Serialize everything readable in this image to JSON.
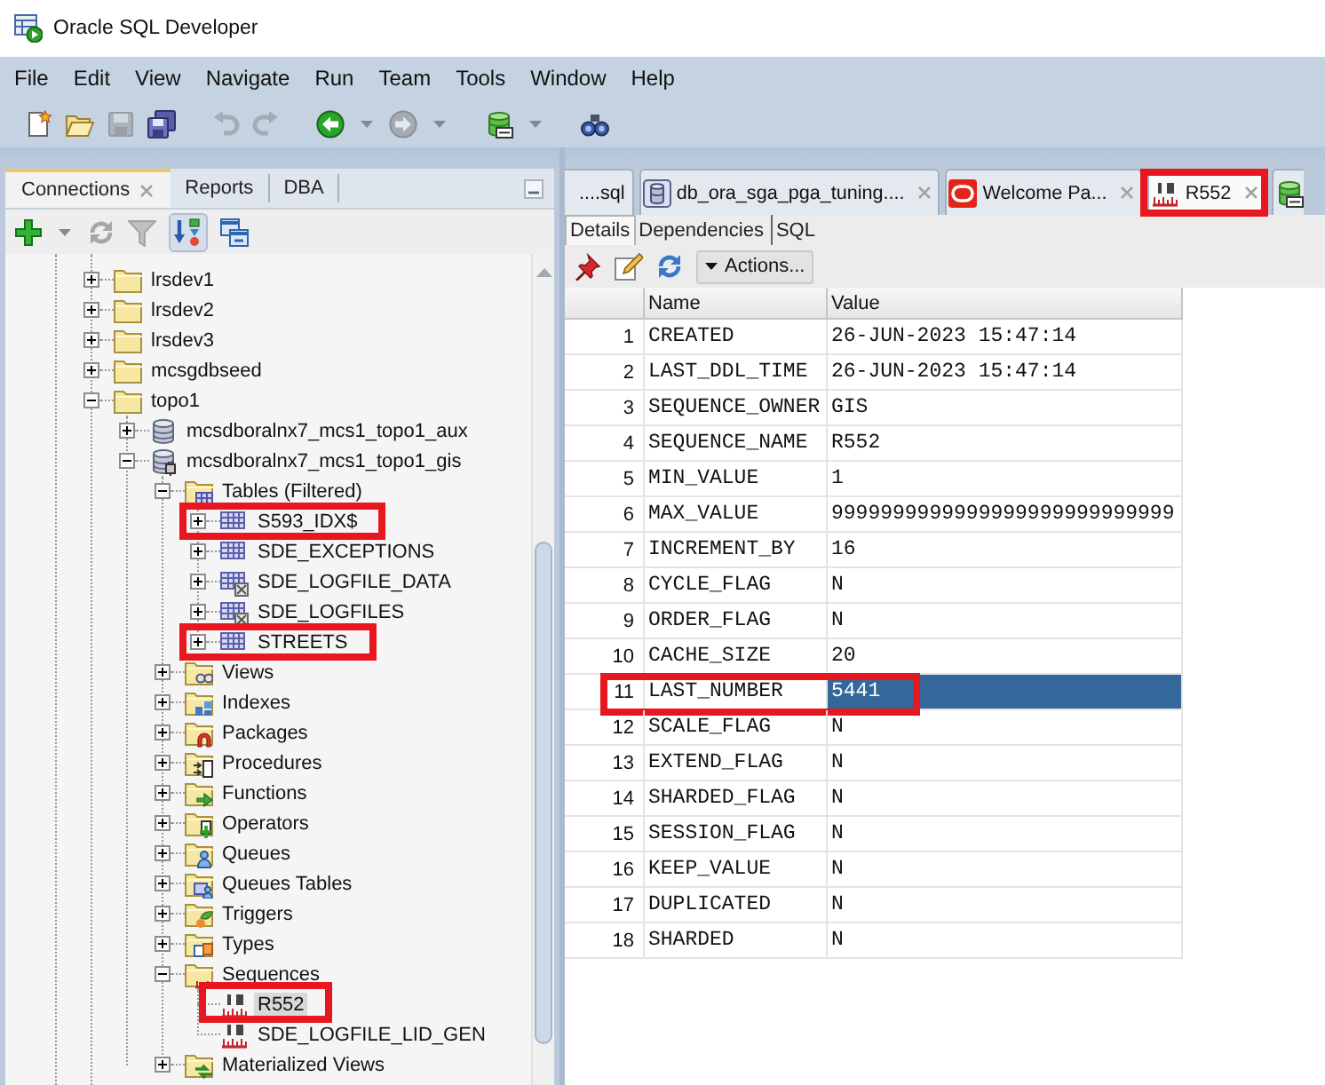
{
  "window": {
    "title": "Oracle SQL Developer"
  },
  "menu_bar": [
    "File",
    "Edit",
    "View",
    "Navigate",
    "Run",
    "Team",
    "Tools",
    "Window",
    "Help"
  ],
  "toolbar": [
    {
      "kind": "new",
      "disabled": false
    },
    {
      "kind": "open",
      "disabled": false
    },
    {
      "kind": "save",
      "disabled": true
    },
    {
      "kind": "save-all",
      "disabled": false
    },
    {
      "kind": "undo",
      "disabled": true
    },
    {
      "kind": "redo",
      "disabled": true
    },
    {
      "kind": "back",
      "disabled": false
    },
    {
      "kind": "dropdown",
      "disabled": false
    },
    {
      "kind": "forward",
      "disabled": true
    },
    {
      "kind": "dropdown",
      "disabled": false
    },
    {
      "kind": "sql",
      "disabled": false
    },
    {
      "kind": "dropdown",
      "disabled": false
    },
    {
      "kind": "find",
      "disabled": false
    }
  ],
  "left_panel": {
    "tabs": [
      {
        "label": "Connections",
        "selected": true,
        "closable": true
      },
      {
        "label": "Reports",
        "selected": false,
        "closable": false
      },
      {
        "label": "DBA",
        "selected": false,
        "closable": false
      }
    ],
    "toolbar": [
      {
        "kind": "add",
        "disabled": false,
        "pressed": false
      },
      {
        "kind": "dropdown",
        "disabled": false,
        "pressed": false
      },
      {
        "kind": "refresh",
        "disabled": true,
        "pressed": false
      },
      {
        "kind": "filter",
        "disabled": true,
        "pressed": false
      },
      {
        "kind": "schema-browser",
        "disabled": false,
        "pressed": true
      },
      {
        "kind": "collapse",
        "disabled": false,
        "pressed": false
      }
    ],
    "tree": [
      {
        "label": "lrsdev1",
        "kind": "folder",
        "expanded": false,
        "selected": false,
        "highlighted": false
      },
      {
        "label": "lrsdev2",
        "kind": "folder",
        "expanded": false,
        "selected": false,
        "highlighted": false
      },
      {
        "label": "lrsdev3",
        "kind": "folder",
        "expanded": false,
        "selected": false,
        "highlighted": false
      },
      {
        "label": "mcsgdbseed",
        "kind": "folder",
        "expanded": false,
        "selected": false,
        "highlighted": false
      },
      {
        "label": "topo1",
        "kind": "folder",
        "expanded": true,
        "selected": false,
        "highlighted": false,
        "children": [
          {
            "label": "mcsdboralnx7_mcs1_topo1_aux",
            "kind": "database",
            "expanded": false,
            "selected": false,
            "highlighted": false
          },
          {
            "label": "mcsdboralnx7_mcs1_topo1_gis",
            "kind": "database-connected",
            "expanded": true,
            "selected": false,
            "highlighted": false,
            "children": [
              {
                "label": "Tables (Filtered)",
                "kind": "tables",
                "expanded": true,
                "selected": false,
                "highlighted": false,
                "children": [
                  {
                    "label": "S593_IDX$",
                    "kind": "table",
                    "expanded": false,
                    "selected": false,
                    "highlighted": true
                  },
                  {
                    "label": "SDE_EXCEPTIONS",
                    "kind": "table",
                    "expanded": false,
                    "selected": false,
                    "highlighted": false
                  },
                  {
                    "label": "SDE_LOGFILE_DATA",
                    "kind": "table-x",
                    "expanded": false,
                    "selected": false,
                    "highlighted": false
                  },
                  {
                    "label": "SDE_LOGFILES",
                    "kind": "table-x",
                    "expanded": false,
                    "selected": false,
                    "highlighted": false
                  },
                  {
                    "label": "STREETS",
                    "kind": "table",
                    "expanded": false,
                    "selected": false,
                    "highlighted": true
                  }
                ]
              },
              {
                "label": "Views",
                "kind": "views",
                "expanded": false,
                "selected": false,
                "highlighted": false
              },
              {
                "label": "Indexes",
                "kind": "indexes",
                "expanded": false,
                "selected": false,
                "highlighted": false
              },
              {
                "label": "Packages",
                "kind": "packages",
                "expanded": false,
                "selected": false,
                "highlighted": false
              },
              {
                "label": "Procedures",
                "kind": "procedures",
                "expanded": false,
                "selected": false,
                "highlighted": false
              },
              {
                "label": "Functions",
                "kind": "functions",
                "expanded": false,
                "selected": false,
                "highlighted": false
              },
              {
                "label": "Operators",
                "kind": "operators",
                "expanded": false,
                "selected": false,
                "highlighted": false
              },
              {
                "label": "Queues",
                "kind": "queues",
                "expanded": false,
                "selected": false,
                "highlighted": false
              },
              {
                "label": "Queues Tables",
                "kind": "queue-tables",
                "expanded": false,
                "selected": false,
                "highlighted": false
              },
              {
                "label": "Triggers",
                "kind": "triggers",
                "expanded": false,
                "selected": false,
                "highlighted": false
              },
              {
                "label": "Types",
                "kind": "types",
                "expanded": false,
                "selected": false,
                "highlighted": false
              },
              {
                "label": "Sequences",
                "kind": "sequences",
                "expanded": true,
                "selected": false,
                "highlighted": false,
                "children": [
                  {
                    "label": "R552",
                    "kind": "sequence",
                    "selected": true,
                    "highlighted": true
                  },
                  {
                    "label": "SDE_LOGFILE_LID_GEN",
                    "kind": "sequence",
                    "selected": false,
                    "highlighted": false
                  }
                ]
              },
              {
                "label": "Materialized Views",
                "kind": "mviews",
                "expanded": false,
                "selected": false,
                "highlighted": false
              }
            ]
          }
        ]
      }
    ]
  },
  "right_panel": {
    "editor_tabs": [
      {
        "label": "....sql",
        "kind": "plain",
        "selected": false,
        "closable": false,
        "highlighted": false
      },
      {
        "label": "db_ora_sga_pga_tuning....",
        "kind": "database",
        "selected": false,
        "closable": true,
        "highlighted": false
      },
      {
        "label": "Welcome Pa...",
        "kind": "oracle",
        "selected": false,
        "closable": true,
        "highlighted": false
      },
      {
        "label": "R552",
        "kind": "sequence",
        "selected": true,
        "closable": true,
        "highlighted": true
      },
      {
        "kind": "sql",
        "selected": false,
        "closable": false,
        "highlighted": false
      }
    ],
    "detail_tabs": [
      {
        "label": "Details",
        "selected": true
      },
      {
        "label": "Dependencies",
        "selected": false
      },
      {
        "label": "SQL",
        "selected": false
      }
    ],
    "detail_toolbar": [
      {
        "kind": "pin"
      },
      {
        "kind": "edit"
      },
      {
        "kind": "refresh"
      },
      {
        "kind": "menu-button",
        "label": "Actions..."
      }
    ],
    "grid": {
      "columns": [
        "Name",
        "Value"
      ],
      "rows": [
        {
          "number": "1",
          "name": "CREATED",
          "value": "26-JUN-2023 15:47:14",
          "selected": false,
          "highlighted": false
        },
        {
          "number": "2",
          "name": "LAST_DDL_TIME",
          "value": "26-JUN-2023 15:47:14",
          "selected": false,
          "highlighted": false
        },
        {
          "number": "3",
          "name": "SEQUENCE_OWNER",
          "value": "GIS",
          "selected": false,
          "highlighted": false
        },
        {
          "number": "4",
          "name": "SEQUENCE_NAME",
          "value": "R552",
          "selected": false,
          "highlighted": false
        },
        {
          "number": "5",
          "name": "MIN_VALUE",
          "value": "1",
          "selected": false,
          "highlighted": false
        },
        {
          "number": "6",
          "name": "MAX_VALUE",
          "value": "9999999999999999999999999999",
          "selected": false,
          "highlighted": false
        },
        {
          "number": "7",
          "name": "INCREMENT_BY",
          "value": "16",
          "selected": false,
          "highlighted": false
        },
        {
          "number": "8",
          "name": "CYCLE_FLAG",
          "value": "N",
          "selected": false,
          "highlighted": false
        },
        {
          "number": "9",
          "name": "ORDER_FLAG",
          "value": "N",
          "selected": false,
          "highlighted": false
        },
        {
          "number": "10",
          "name": "CACHE_SIZE",
          "value": "20",
          "selected": false,
          "highlighted": false
        },
        {
          "number": "11",
          "name": "LAST_NUMBER",
          "value": "5441",
          "selected": true,
          "highlighted": true
        },
        {
          "number": "12",
          "name": "SCALE_FLAG",
          "value": "N",
          "selected": false,
          "highlighted": false
        },
        {
          "number": "13",
          "name": "EXTEND_FLAG",
          "value": "N",
          "selected": false,
          "highlighted": false
        },
        {
          "number": "14",
          "name": "SHARDED_FLAG",
          "value": "N",
          "selected": false,
          "highlighted": false
        },
        {
          "number": "15",
          "name": "SESSION_FLAG",
          "value": "N",
          "selected": false,
          "highlighted": false
        },
        {
          "number": "16",
          "name": "KEEP_VALUE",
          "value": "N",
          "selected": false,
          "highlighted": false
        },
        {
          "number": "17",
          "name": "DUPLICATED",
          "value": "N",
          "selected": false,
          "highlighted": false
        },
        {
          "number": "18",
          "name": "SHARDED",
          "value": "N",
          "selected": false,
          "highlighted": false
        }
      ]
    }
  }
}
